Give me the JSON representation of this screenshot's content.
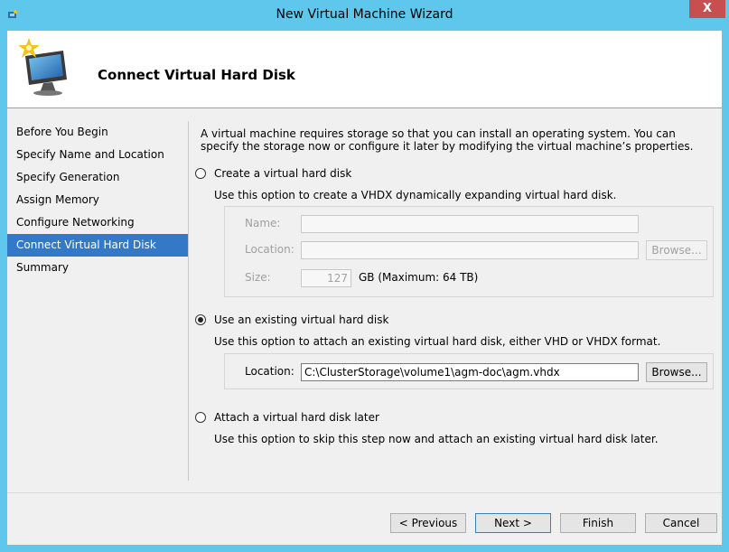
{
  "window": {
    "title": "New Virtual Machine Wizard",
    "close_label": "X"
  },
  "header": {
    "title": "Connect Virtual Hard Disk",
    "icon": "monitor-sparkle-icon"
  },
  "nav": {
    "items": [
      {
        "label": "Before You Begin",
        "selected": false
      },
      {
        "label": "Specify Name and Location",
        "selected": false
      },
      {
        "label": "Specify Generation",
        "selected": false
      },
      {
        "label": "Assign Memory",
        "selected": false
      },
      {
        "label": "Configure Networking",
        "selected": false
      },
      {
        "label": "Connect Virtual Hard Disk",
        "selected": true
      },
      {
        "label": "Summary",
        "selected": false
      }
    ]
  },
  "content": {
    "description": "A virtual machine requires storage so that you can install an operating system. You can specify the storage now or configure it later by modifying the virtual machine’s properties.",
    "create": {
      "label": "Create a virtual hard disk",
      "checked": false,
      "description": "Use this option to create a VHDX dynamically expanding virtual hard disk.",
      "name_label": "Name:",
      "name_value": "",
      "location_label": "Location:",
      "location_value": "",
      "browse_label": "Browse...",
      "size_label": "Size:",
      "size_value": "127",
      "size_unit": "GB (Maximum: 64 TB)"
    },
    "existing": {
      "label": "Use an existing virtual hard disk",
      "checked": true,
      "description": "Use this option to attach an existing virtual hard disk, either VHD or VHDX format.",
      "location_label": "Location:",
      "location_value": "C:\\ClusterStorage\\volume1\\agm-doc\\agm.vhdx",
      "browse_label": "Browse..."
    },
    "later": {
      "label": "Attach a virtual hard disk later",
      "checked": false,
      "description": "Use this option to skip this step now and attach an existing virtual hard disk later."
    }
  },
  "footer": {
    "previous_label": "< Previous",
    "next_label": "Next >",
    "finish_label": "Finish",
    "cancel_label": "Cancel"
  },
  "colors": {
    "titlebar": "#5fc7eb",
    "nav_selected": "#3379c7",
    "close_button": "#c74f4f"
  }
}
